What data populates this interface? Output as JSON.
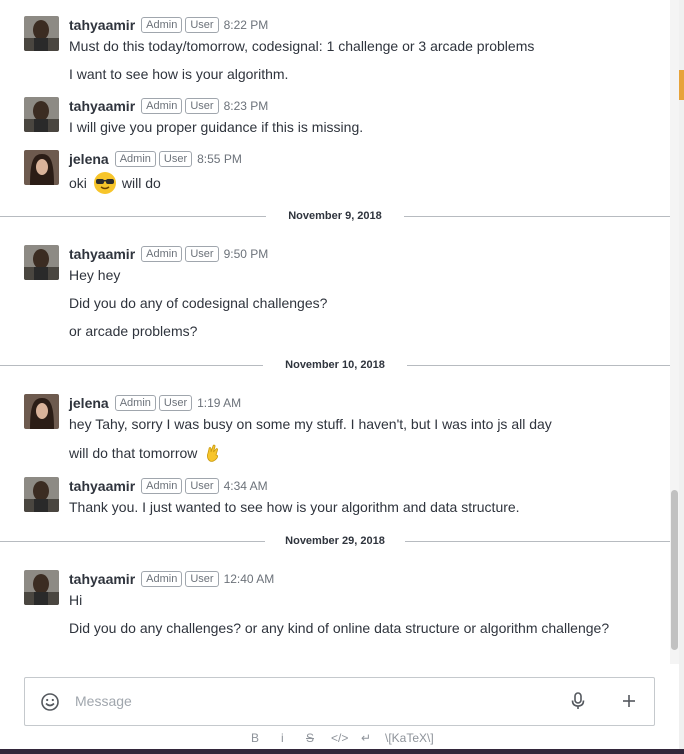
{
  "messages": [
    {
      "user": "tahyaamir",
      "badges": [
        "Admin",
        "User"
      ],
      "time": "8:22 PM",
      "lines": [
        "Must do this today/tomorrow, codesignal: 1 challenge or 3 arcade problems",
        "I want to see how is your algorithm."
      ]
    },
    {
      "user": "tahyaamir",
      "badges": [
        "Admin",
        "User"
      ],
      "time": "8:23 PM",
      "lines": [
        "I will give you proper guidance if this is missing."
      ]
    },
    {
      "user": "jelena",
      "badges": [
        "Admin",
        "User"
      ],
      "time": "8:55 PM",
      "text_before_emoji": "oki",
      "emoji": "sunglasses-emoji",
      "text_after_emoji": "will do"
    },
    {
      "user": "tahyaamir",
      "badges": [
        "Admin",
        "User"
      ],
      "time": "9:50 PM",
      "lines": [
        "Hey hey",
        "Did you do any of codesignal challenges?",
        "or arcade problems?"
      ]
    },
    {
      "user": "jelena",
      "badges": [
        "Admin",
        "User"
      ],
      "time": "1:19 AM",
      "lines": [
        "hey Tahy, sorry I was busy on some my stuff. I haven't, but I was into js all day",
        "will do that tomorrow"
      ],
      "emoji": "crossed-fingers-emoji"
    },
    {
      "user": "tahyaamir",
      "badges": [
        "Admin",
        "User"
      ],
      "time": "4:34 AM",
      "lines": [
        "Thank you. I just wanted to see how is your algorithm and data structure."
      ]
    },
    {
      "user": "tahyaamir",
      "badges": [
        "Admin",
        "User"
      ],
      "time": "12:40 AM",
      "lines": [
        "Hi",
        "Did you do any challenges? or any kind of online data structure or algorithm challenge?"
      ]
    }
  ],
  "dividers": [
    "November 9, 2018",
    "November 10, 2018",
    "November 29, 2018"
  ],
  "composer": {
    "placeholder": "Message",
    "emoji_icon": "smiley-icon",
    "mic_icon": "microphone-icon",
    "add_icon": "plus-icon"
  },
  "format_bar": {
    "bold": "B",
    "italic": "i",
    "strike": "S",
    "code": "</>",
    "multiline": "↵",
    "katex": "\\[KaTeX\\]"
  },
  "colors": {
    "text": "#2f343d",
    "muted": "#6c727a",
    "badge_border": "#a0a6ad",
    "bottom_bar": "#33273b",
    "emoji_yellow": "#f7c52b"
  }
}
